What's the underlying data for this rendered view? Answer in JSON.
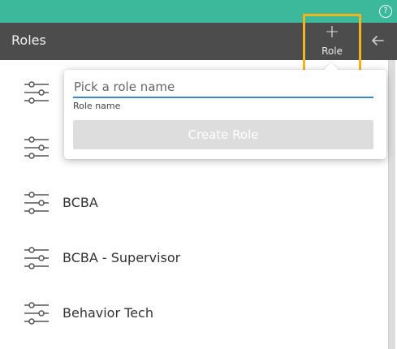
{
  "header": {
    "title": "Roles",
    "add_button": {
      "plus": "+",
      "label": "Role"
    },
    "help_glyph": "?",
    "back_icon": "arrow-left-icon"
  },
  "roles": [
    {
      "label": ""
    },
    {
      "label": ""
    },
    {
      "label": "BCBA"
    },
    {
      "label": "BCBA - Supervisor"
    },
    {
      "label": "Behavior Tech"
    }
  ],
  "popover": {
    "placeholder": "Pick a role name",
    "value": "",
    "field_label": "Role name",
    "create_button": "Create Role"
  },
  "colors": {
    "topbar": "#3bb99a",
    "header": "#4c4c4c",
    "highlight": "#f3b51b",
    "input_underline": "#3a87c9",
    "disabled_button": "#dddddd"
  }
}
